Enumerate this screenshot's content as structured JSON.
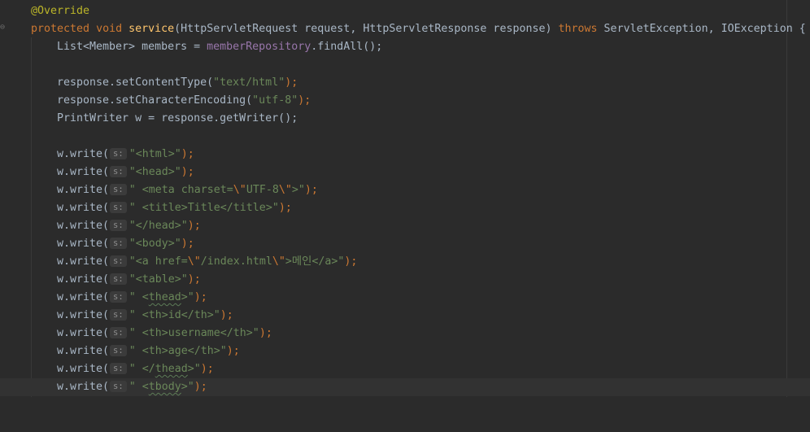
{
  "editor": {
    "hint_label": "s:",
    "lines": {
      "l1": {
        "annotation": "@Override"
      },
      "l2": {
        "kw_protected": "protected",
        "kw_void": "void",
        "method_name": "service",
        "params": "(HttpServletRequest request, HttpServletResponse response) ",
        "kw_throws": "throws",
        "exceptions": " ServletException, IOException {"
      },
      "l3": {
        "prefix": "List<Member> members = ",
        "field": "memberRepository",
        "suffix": ".findAll();"
      },
      "l5": {
        "call": "response.setContentType(",
        "arg": "\"text/html\"",
        "end": ");"
      },
      "l6": {
        "call": "response.setCharacterEncoding(",
        "arg": "\"utf-8\"",
        "end": ");"
      },
      "l7": {
        "text": "PrintWriter w = response.getWriter();"
      },
      "writes": {
        "call": "w.write(",
        "end": ");",
        "w1": "\"<html>\"",
        "w2": "\"<head>\"",
        "w3_a": "\" <meta charset=",
        "w3_esc1": "\\\"",
        "w3_b": "UTF-8",
        "w3_esc2": "\\\"",
        "w3_c": ">\"",
        "w4": "\" <title>Title</title>\"",
        "w5": "\"</head>\"",
        "w6": "\"<body>\"",
        "w7_a": "\"<a href=",
        "w7_esc1": "\\\"",
        "w7_b": "/index.html",
        "w7_esc2": "\\\"",
        "w7_c": ">메인</a>\"",
        "w8": "\"<table>\"",
        "w9_a": "\" <",
        "w9_typo": "thead",
        "w9_b": ">\"",
        "w10": "\" <th>id</th>\"",
        "w11": "\" <th>username</th>\"",
        "w12": "\" <th>age</th>\"",
        "w13_a": "\" </",
        "w13_typo": "thead",
        "w13_b": ">\"",
        "w14_a": "\" <",
        "w14_typo": "tbody",
        "w14_b": ">\""
      }
    }
  },
  "colors": {
    "background": "#2b2b2b",
    "default_text": "#a9b7c6",
    "keyword": "#cc7832",
    "string": "#6a8759",
    "method_declaration": "#ffc66d",
    "field": "#9876aa",
    "annotation": "#bbb529",
    "current_line": "#323232"
  }
}
